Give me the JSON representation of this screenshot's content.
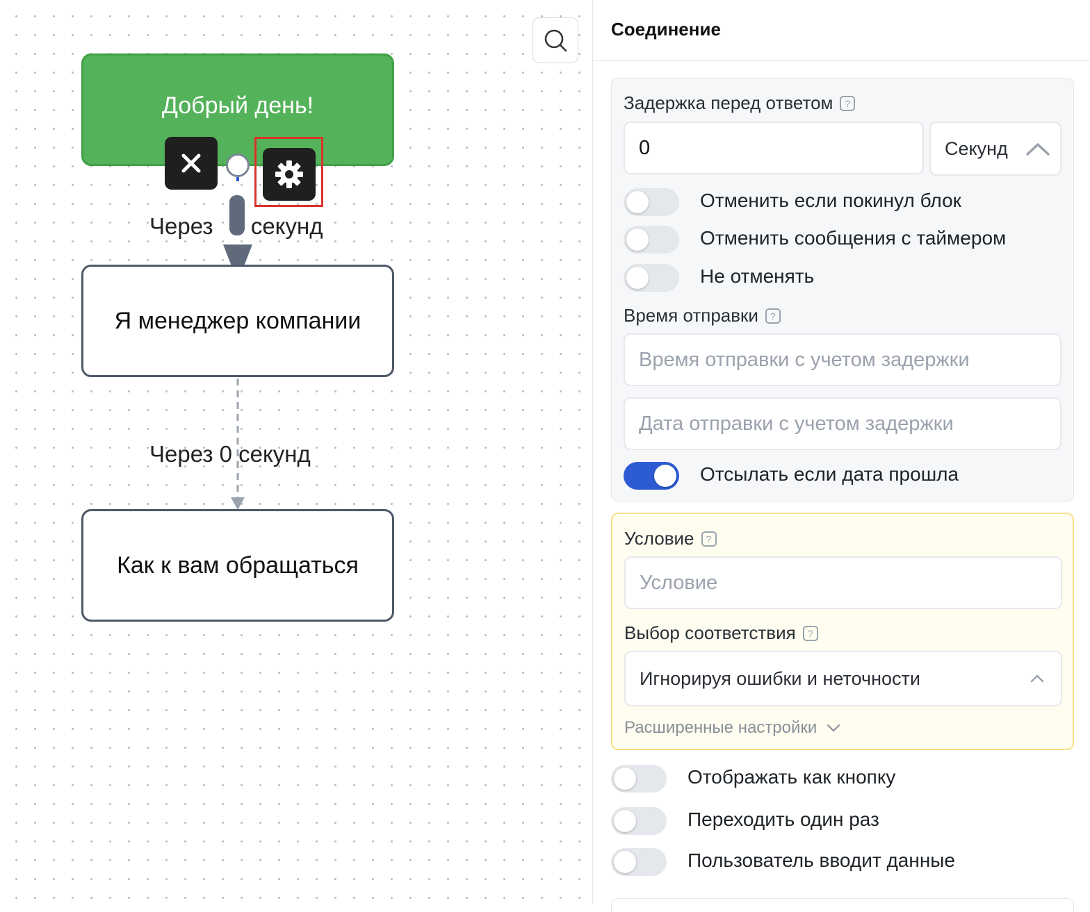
{
  "canvas": {
    "nodes": [
      {
        "text": "Добрый день!"
      },
      {
        "text": "Я менеджер компании"
      },
      {
        "text": "Как к вам обращаться"
      }
    ],
    "edges": [
      {
        "label_part1": "Через",
        "label_part2": "секунд"
      },
      {
        "label": "Через 0 секунд"
      }
    ],
    "colors": {
      "start_node": "#54b25a",
      "highlight": "#d9342b"
    }
  },
  "panel": {
    "title": "Соединение",
    "delay": {
      "label": "Задержка перед ответом",
      "value": "0",
      "unit": "Секунд",
      "toggles": [
        {
          "label": "Отменить если покинул блок",
          "on": false
        },
        {
          "label": "Отменить сообщения с таймером",
          "on": false
        },
        {
          "label": "Не отменять",
          "on": false
        }
      ]
    },
    "send_time": {
      "label": "Время отправки",
      "time_placeholder": "Время отправки с учетом задержки",
      "date_placeholder": "Дата отправки с учетом задержки",
      "send_if_past": {
        "label": "Отсылать если дата прошла",
        "on": true
      }
    },
    "condition": {
      "label": "Условие",
      "placeholder": "Условие",
      "match_label": "Выбор соответствия",
      "match_value": "Игнорируя ошибки и неточности",
      "advanced": "Расширенные настройки"
    },
    "bottom_toggles": [
      {
        "label": "Отображать как кнопку",
        "on": false
      },
      {
        "label": "Переходить один раз",
        "on": false
      },
      {
        "label": "Пользователь вводит данные",
        "on": false
      }
    ],
    "accent": "#2d5bd3"
  }
}
